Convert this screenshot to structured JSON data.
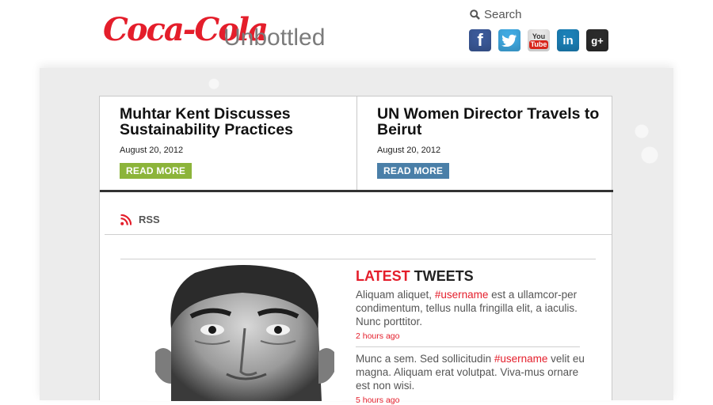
{
  "header": {
    "brand": "Coca-Cola",
    "subbrand": "Unbottled",
    "search_label": "Search"
  },
  "social": [
    {
      "name": "facebook",
      "glyph": "f"
    },
    {
      "name": "twitter",
      "glyph": ""
    },
    {
      "name": "youtube",
      "you": "You",
      "tube": "Tube"
    },
    {
      "name": "linkedin",
      "glyph": "in"
    },
    {
      "name": "google-plus",
      "glyph": "g+"
    }
  ],
  "stories": [
    {
      "title": "Muhtar Kent Discusses Sustainability Practices",
      "date": "August 20, 2012",
      "button": "READ MORE",
      "button_color": "#8cb43a"
    },
    {
      "title": "UN Women Director Travels to Beirut",
      "date": "August 20, 2012",
      "button": "READ MORE",
      "button_color": "#4a7fa8"
    }
  ],
  "rss_label": "RSS",
  "tweets": {
    "heading_accent": "LATEST",
    "heading_rest": " TWEETS",
    "items": [
      {
        "pre": "Aliquam aliquet, ",
        "tag": "#username",
        "post": " est a ullamcor-per condimentum, tellus nulla fringilla elit, a iaculis. Nunc porttitor.",
        "time": "2 hours ago"
      },
      {
        "pre": "Munc a sem. Sed sollicitudin ",
        "tag": "#username",
        "post": " velit eu magna. Aliquam erat volutpat. Viva-mus ornare est non wisi.",
        "time": "5 hours ago"
      }
    ]
  },
  "colors": {
    "brand_red": "#e41e2b",
    "green_button": "#8cb43a",
    "blue_button": "#4a7fa8"
  }
}
